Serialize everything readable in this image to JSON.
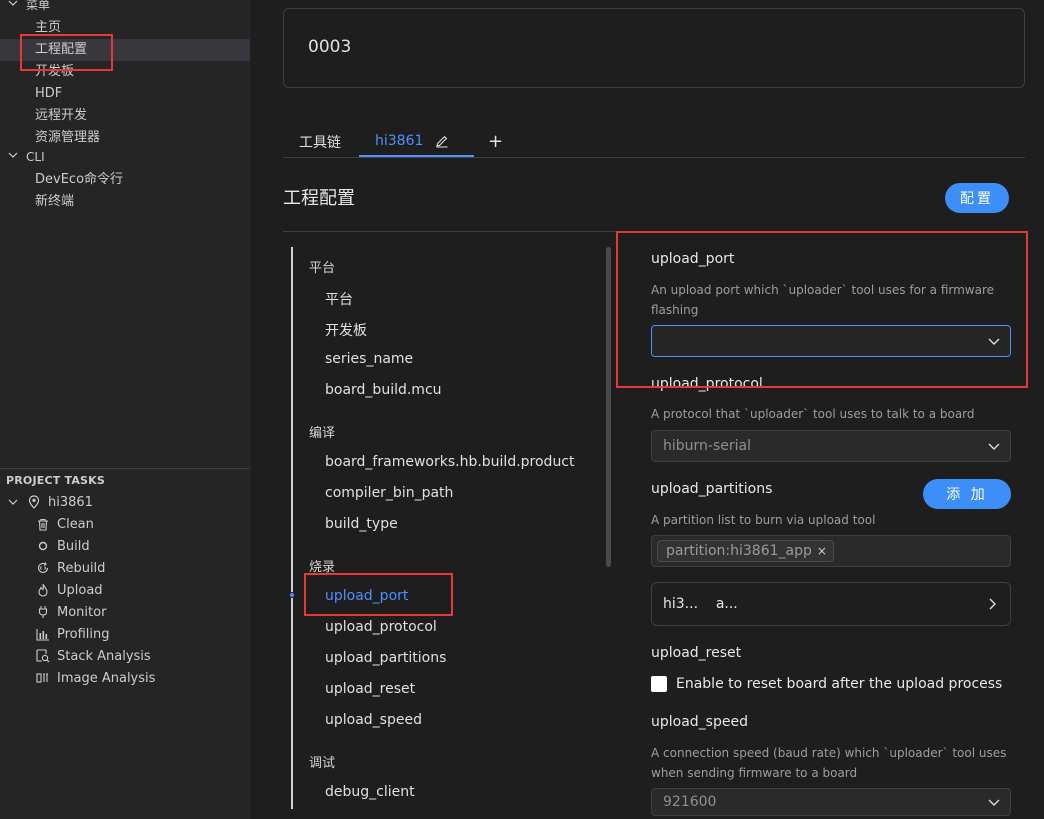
{
  "sidebar": {
    "menu_header": "菜单",
    "menu_items": [
      "主页",
      "工程配置",
      "开发板",
      "HDF",
      "远程开发",
      "资源管理器"
    ],
    "cli_header": "CLI",
    "cli_items": [
      "DevEco命令行",
      "新终端"
    ],
    "tasks_title": "PROJECT TASKS",
    "project_name": "hi3861",
    "tasks": [
      "Clean",
      "Build",
      "Rebuild",
      "Upload",
      "Monitor",
      "Profiling",
      "Stack Analysis",
      "Image Analysis"
    ]
  },
  "main": {
    "project_name_value": "0003",
    "tabs": [
      "工具链",
      "hi3861"
    ],
    "add_tab_symbol": "+",
    "section_title": "工程配置",
    "config_button": "配置"
  },
  "toc": {
    "groups": [
      {
        "label": "平台",
        "items": [
          "平台",
          "开发板",
          "series_name",
          "board_build.mcu"
        ]
      },
      {
        "label": "编译",
        "items": [
          "board_frameworks.hb.build.product",
          "compiler_bin_path",
          "build_type"
        ]
      },
      {
        "label": "烧录",
        "items": [
          "upload_port",
          "upload_protocol",
          "upload_partitions",
          "upload_reset",
          "upload_speed"
        ]
      },
      {
        "label": "调试",
        "items": [
          "debug_client"
        ]
      }
    ],
    "active_item": "upload_port"
  },
  "form": {
    "upload_port": {
      "label": "upload_port",
      "description": "An upload port which `uploader` tool uses for a firmware flashing",
      "value": ""
    },
    "upload_protocol": {
      "label": "upload_protocol",
      "description": "A protocol that `uploader` tool uses to talk to a board",
      "value": "hiburn-serial"
    },
    "upload_partitions": {
      "label": "upload_partitions",
      "add_button": "添 加",
      "description": "A partition list to burn via upload tool",
      "chip": "partition:hi3861_app",
      "chip_close": "×",
      "row_text": "hi3...    a..."
    },
    "upload_reset": {
      "label": "upload_reset",
      "checkbox_label": "Enable to reset board after the upload process",
      "checked": false
    },
    "upload_speed": {
      "label": "upload_speed",
      "description": "A connection speed (baud rate) which `uploader` tool uses when sending firmware to a board",
      "value": "921600"
    }
  },
  "colors": {
    "accent": "#4d90fe",
    "button": "#3d8ef8",
    "highlight": "#e53935"
  }
}
